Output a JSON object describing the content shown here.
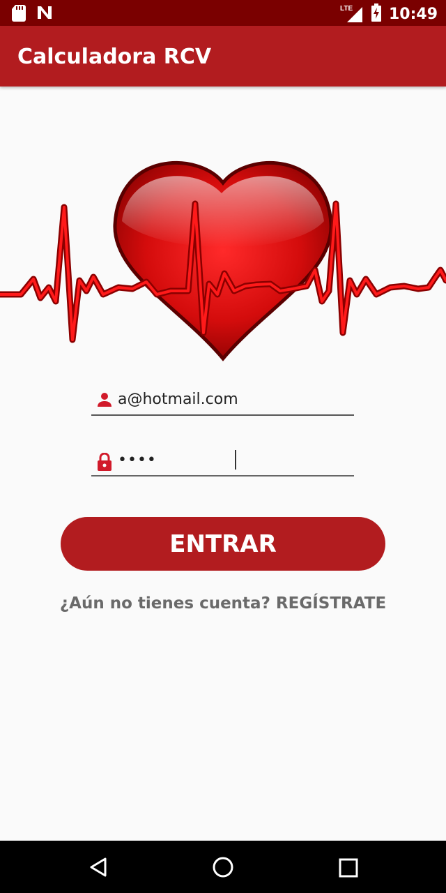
{
  "status_bar": {
    "network_label": "LTE",
    "time": "10:49"
  },
  "app_bar": {
    "title": "Calculadora RCV"
  },
  "login": {
    "email_value": "a@hotmail.com",
    "password_value": "••••",
    "submit_label": "ENTRAR",
    "register_text": "¿Aún no tienes cuenta? REGÍSTRATE"
  },
  "colors": {
    "accent": "#b21c1f",
    "status_bar": "#7a0000",
    "background": "#fafafa"
  },
  "icons": {
    "email_field": "person-icon",
    "password_field": "lock-icon",
    "nav": [
      "back-icon",
      "home-icon",
      "recents-icon"
    ]
  }
}
